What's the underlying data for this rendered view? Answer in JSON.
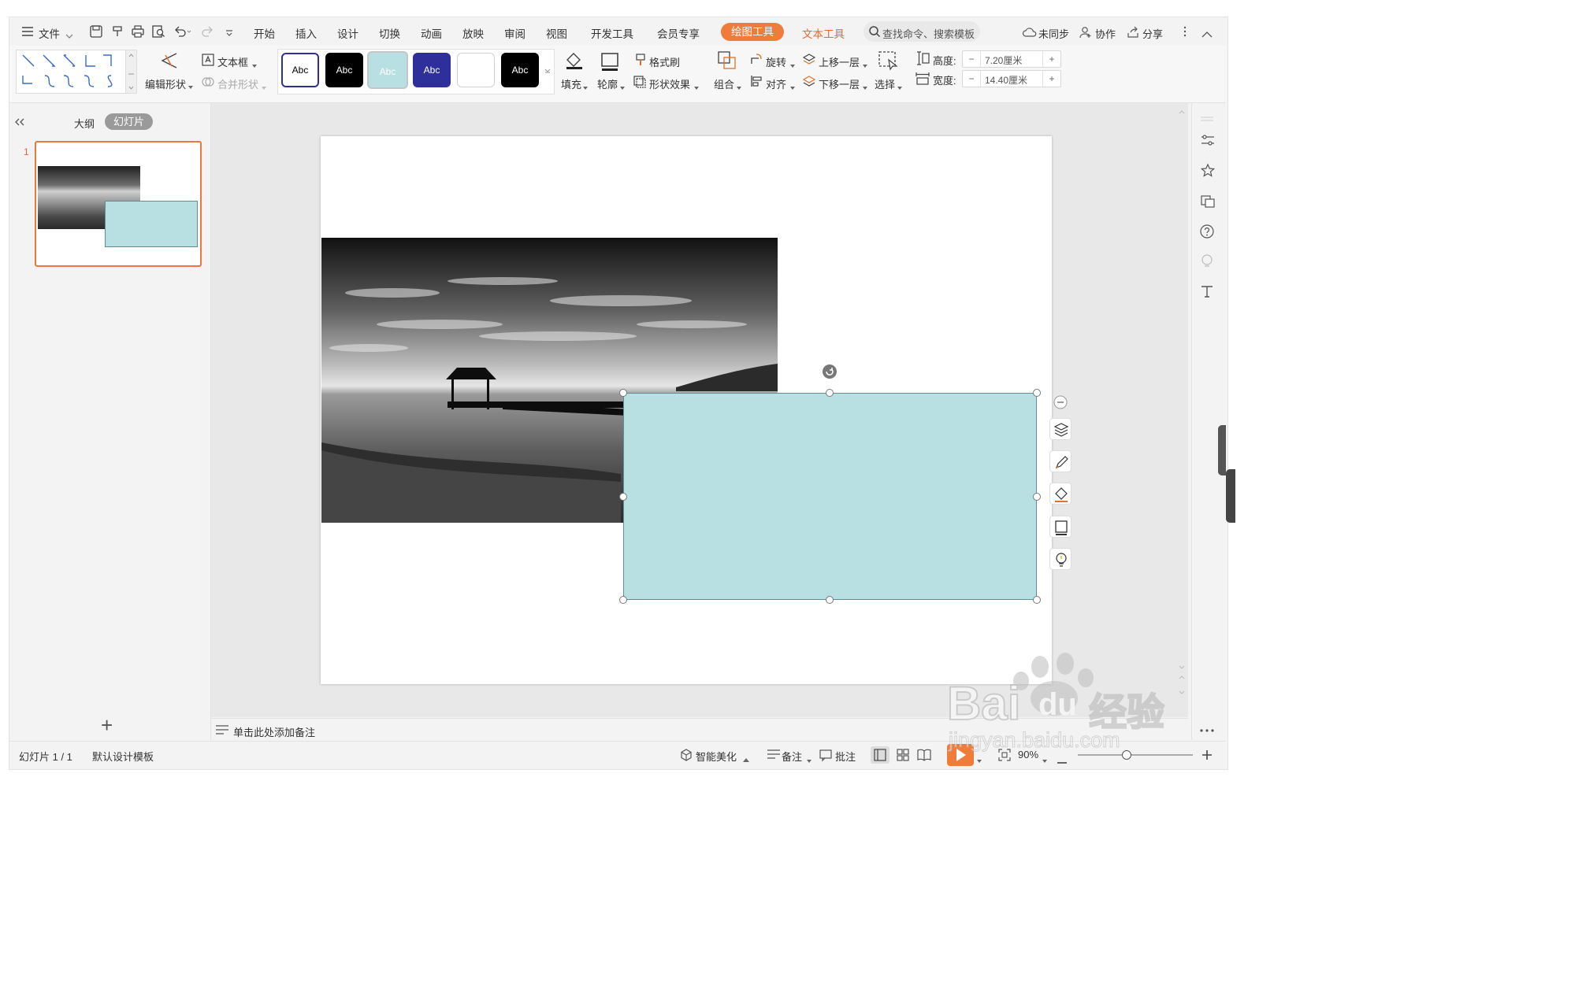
{
  "menu": {
    "file_label": "文件",
    "tabs": [
      "开始",
      "插入",
      "设计",
      "切换",
      "动画",
      "放映",
      "审阅",
      "视图",
      "开发工具",
      "会员专享"
    ],
    "active_tab": "绘图工具",
    "text_tool_tab": "文本工具",
    "search_placeholder": "查找命令、搜索模板",
    "sync_label": "未同步",
    "collab_label": "协作",
    "share_label": "分享"
  },
  "ribbon": {
    "edit_shape": "编辑形状",
    "textbox": "文本框",
    "merge_shape": "合并形状",
    "style_samples": [
      "Abc",
      "Abc",
      "Abc",
      "Abc",
      "",
      "Abc"
    ],
    "fill": "填充",
    "outline": "轮廓",
    "format_painter": "格式刷",
    "shape_effect": "形状效果",
    "group": "组合",
    "rotate": "旋转",
    "align": "对齐",
    "bring_forward": "上移一层",
    "send_backward": "下移一层",
    "select": "选择",
    "height_label": "高度:",
    "height_value": "7.20厘米",
    "width_label": "宽度:",
    "width_value": "14.40厘米"
  },
  "panel": {
    "outline_tab": "大纲",
    "slides_tab": "幻灯片",
    "slide_number": "1",
    "add_slide": "+"
  },
  "notes": {
    "placeholder": "单击此处添加备注"
  },
  "status": {
    "slide_info": "幻灯片 1 / 1",
    "template": "默认设计模板",
    "beautify": "智能美化",
    "notes": "备注",
    "comment": "批注",
    "zoom": "90%"
  },
  "watermark": {
    "brand": "Bai",
    "brand2": "du",
    "cn": "经验",
    "url": "jingyan.baidu.com"
  },
  "colors": {
    "accent": "#f07c3c",
    "shape_fill": "#b8dfe1",
    "shape_border": "#5e8f97",
    "style_dark_blue": "#2f2f9c"
  }
}
